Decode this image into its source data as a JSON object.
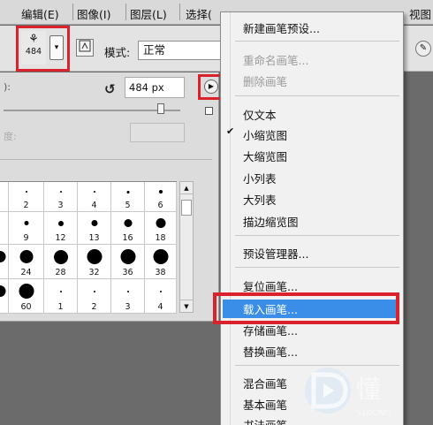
{
  "menubar": {
    "items": [
      "编辑(E)",
      "图像(I)",
      "图层(L)",
      "选择(",
      "视图"
    ]
  },
  "options_bar": {
    "brush_size": "484",
    "brush_glyph": "⚘",
    "dropdown_arrow": "▾",
    "toggle_icon": "brush-panel-icon",
    "mode_label": "模式:",
    "mode_value": "正常"
  },
  "brush_picker": {
    "diameter_label": "):",
    "reset_symbol": "↺",
    "diameter_value": "484 px",
    "flyout_arrow": "▶",
    "hardness_label": "度:",
    "presets": [
      [
        "",
        "2",
        "3",
        "4",
        "5",
        "6"
      ],
      [
        "",
        "9",
        "12",
        "13",
        "16",
        "18"
      ],
      [
        "",
        "24",
        "28",
        "32",
        "36",
        "38"
      ],
      [
        "",
        "60",
        "1",
        "2",
        "3",
        "4"
      ]
    ],
    "scroll_up": "▲",
    "scroll_down": "▼"
  },
  "context_menu": {
    "items": [
      {
        "label": "新建画笔预设...",
        "enabled": true
      },
      {
        "label": "重命名画笔...",
        "enabled": false
      },
      {
        "label": "删除画笔",
        "enabled": false
      },
      {
        "label": "仅文本",
        "enabled": true
      },
      {
        "label": "小缩览图",
        "enabled": true,
        "checked": true
      },
      {
        "label": "大缩览图",
        "enabled": true
      },
      {
        "label": "小列表",
        "enabled": true
      },
      {
        "label": "大列表",
        "enabled": true
      },
      {
        "label": "描边缩览图",
        "enabled": true
      },
      {
        "label": "预设管理器...",
        "enabled": true
      },
      {
        "label": "复位画笔...",
        "enabled": true
      },
      {
        "label": "载入画笔...",
        "enabled": true,
        "highlighted": true
      },
      {
        "label": "存储画笔...",
        "enabled": true
      },
      {
        "label": "替换画笔...",
        "enabled": true
      },
      {
        "label": "混合画笔",
        "enabled": true
      },
      {
        "label": "基本画笔",
        "enabled": true
      },
      {
        "label": "书法画笔",
        "enabled": true
      }
    ],
    "checkmark": "✔"
  },
  "watermark": {
    "big": "懂",
    "small": "51DONG"
  },
  "colors": {
    "highlight": "#3b8ee8",
    "annotation": "#d9222b",
    "disabled": "#9a9a9a"
  }
}
